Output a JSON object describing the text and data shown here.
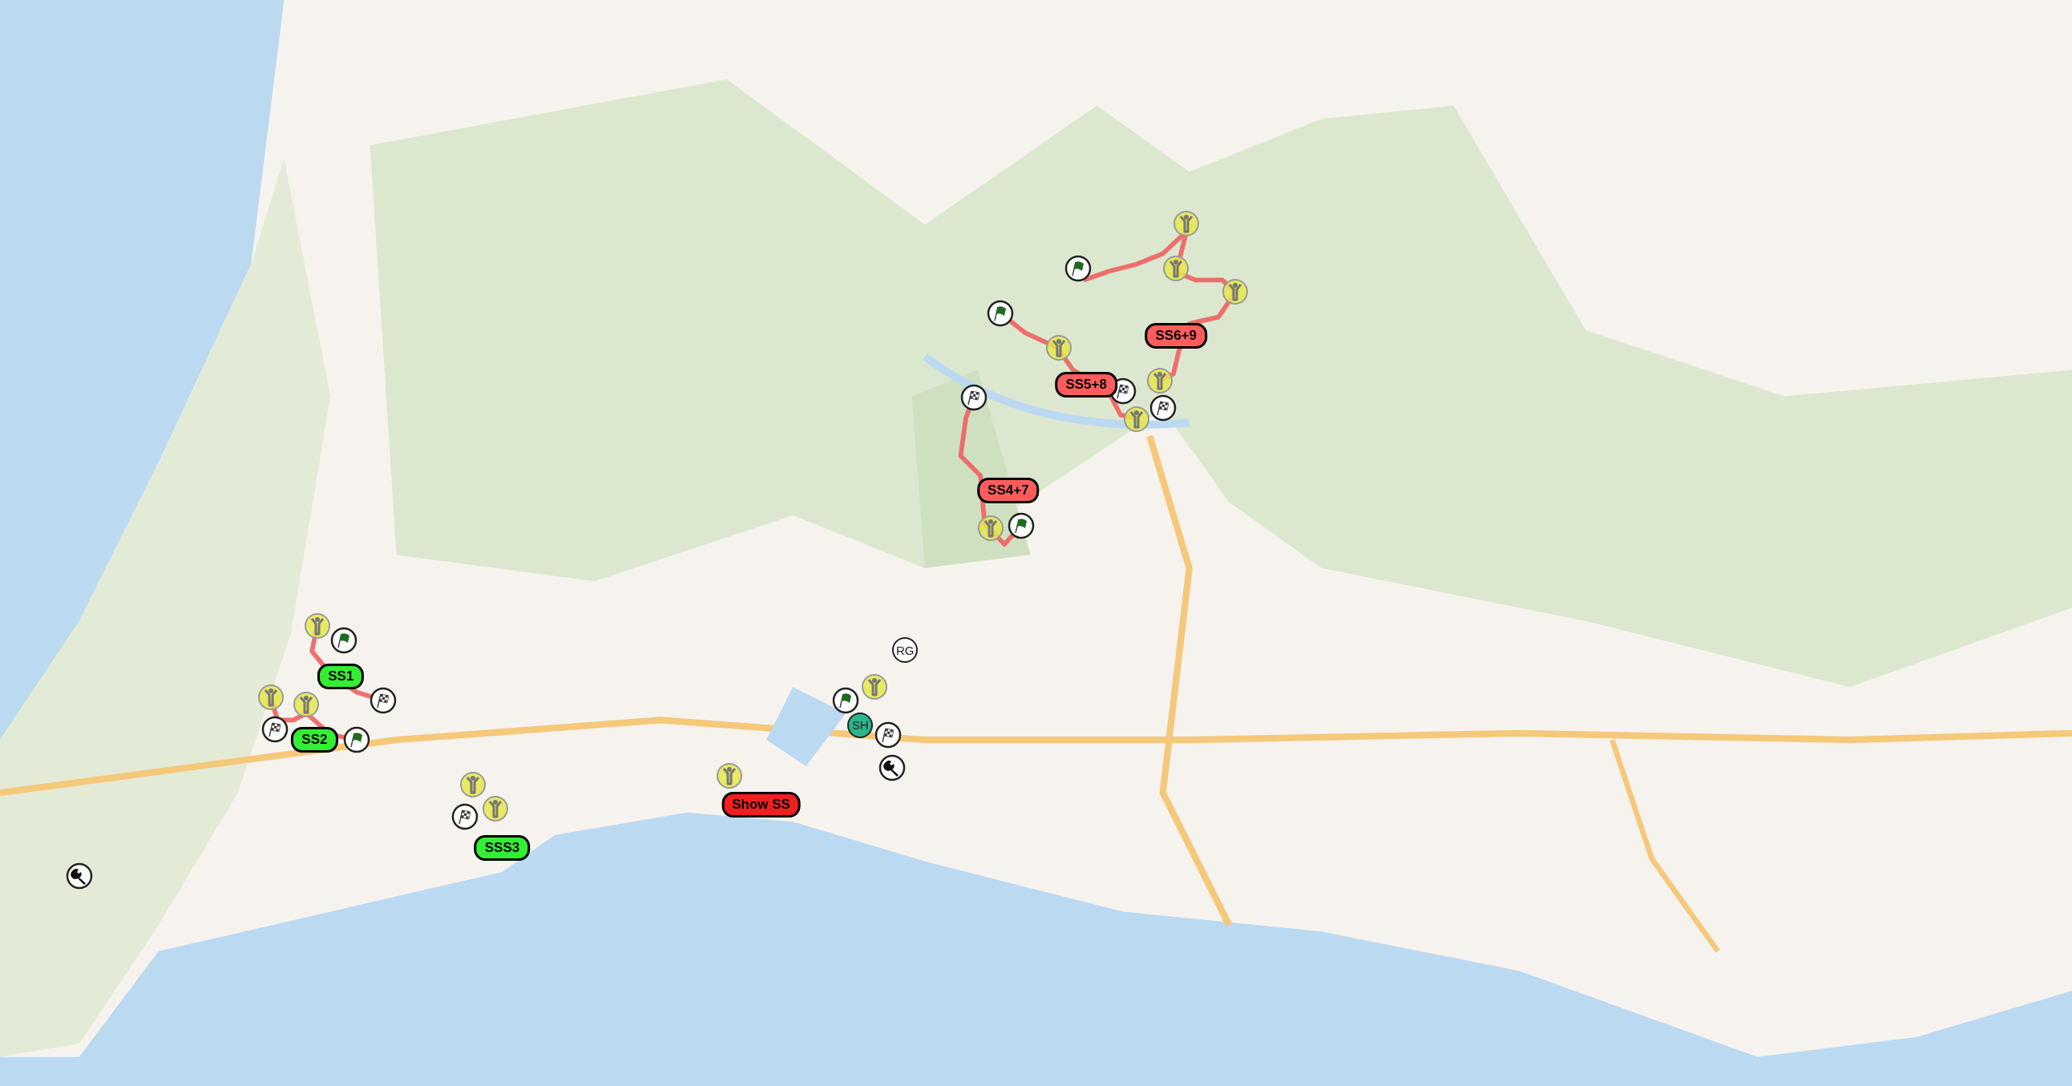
{
  "routes": [
    {
      "kind": "stage"
    },
    {
      "kind": "stage"
    },
    {
      "kind": "stage"
    },
    {
      "kind": "stage"
    },
    {
      "kind": "stage"
    }
  ],
  "markers": [
    {
      "kind": "spectator"
    },
    {
      "kind": "spectator"
    },
    {
      "kind": "flag"
    },
    {
      "kind": "spectator"
    },
    {
      "kind": "flag"
    },
    {
      "kind": "spectator"
    },
    {
      "kind": "spectator"
    },
    {
      "kind": "finish"
    },
    {
      "kind": "finish"
    },
    {
      "kind": "finish"
    },
    {
      "kind": "spectator"
    },
    {
      "kind": "spectator"
    },
    {
      "kind": "flag"
    },
    {
      "kind": "spectator"
    },
    {
      "kind": "flag"
    },
    {
      "kind": "text",
      "label": "RG"
    },
    {
      "kind": "finish"
    },
    {
      "kind": "spectator"
    },
    {
      "kind": "flag"
    },
    {
      "kind": "spectator"
    },
    {
      "kind": "spectator"
    },
    {
      "kind": "text",
      "label": "SH",
      "color": "#2bb58a"
    },
    {
      "kind": "finish"
    },
    {
      "kind": "finish"
    },
    {
      "kind": "flag"
    },
    {
      "kind": "service"
    },
    {
      "kind": "spectator"
    },
    {
      "kind": "spectator"
    },
    {
      "kind": "finish"
    },
    {
      "kind": "spectator"
    },
    {
      "kind": "service"
    }
  ],
  "stages": [
    {
      "label": "SS6+9",
      "color": "#ff5c5c"
    },
    {
      "label": "SS5+8",
      "color": "#ff5c5c"
    },
    {
      "label": "SS4+7",
      "color": "#ff5c5c"
    },
    {
      "label": "SS1",
      "color": "#33ee33"
    },
    {
      "label": "SS2",
      "color": "#33ee33"
    },
    {
      "label": "Show SS",
      "color": "#f21f1f"
    },
    {
      "label": "SSS3",
      "color": "#33ee33"
    }
  ]
}
